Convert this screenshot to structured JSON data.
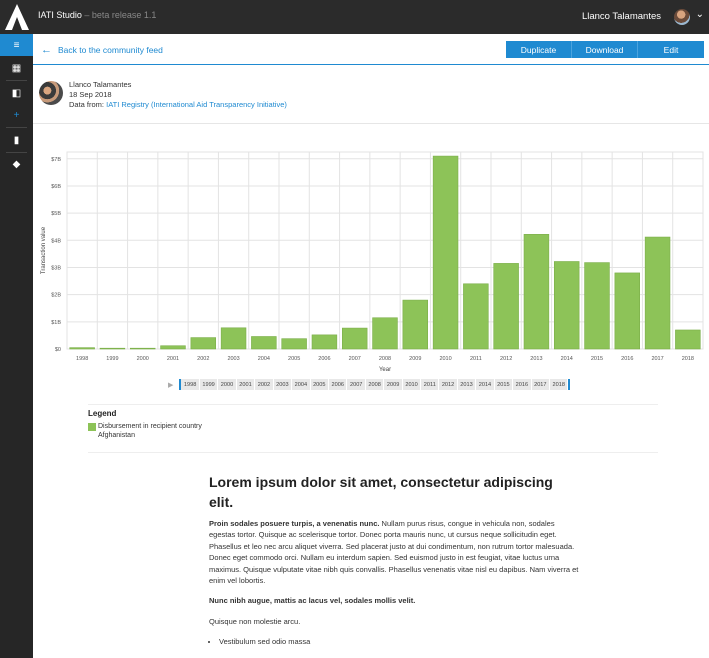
{
  "app": {
    "title": "IATI Studio",
    "subtitle": "– beta release 1.1",
    "user_name": "Llanco Talamantes"
  },
  "sidebar": {
    "items": [
      {
        "icon": "menu-icon",
        "glyph": "≡",
        "active": true
      },
      {
        "icon": "dashboard-icon",
        "glyph": "▦",
        "active": false
      },
      {
        "icon": "gallery-icon",
        "glyph": "◧",
        "active": false
      },
      {
        "icon": "add-icon",
        "glyph": "+",
        "active": false
      },
      {
        "icon": "trash-icon",
        "glyph": "▮",
        "active": false
      },
      {
        "icon": "education-icon",
        "glyph": "◆",
        "active": false
      }
    ]
  },
  "toolbar": {
    "back_label": "Back to the community feed",
    "duplicate_label": "Duplicate",
    "download_label": "Download",
    "edit_label": "Edit"
  },
  "author": {
    "name": "Llanco Talamantes",
    "date": "18 Sep 2018",
    "data_from_label": "Data from:",
    "data_source": "IATI Registry (International Aid Transparency Initiative)"
  },
  "chart_data": {
    "type": "bar",
    "categories": [
      "1998",
      "1999",
      "2000",
      "2001",
      "2002",
      "2003",
      "2004",
      "2005",
      "2006",
      "2007",
      "2008",
      "2009",
      "2010",
      "2011",
      "2012",
      "2013",
      "2014",
      "2015",
      "2016",
      "2017",
      "2018"
    ],
    "values": [
      0.05,
      0.03,
      0.03,
      0.12,
      0.42,
      0.78,
      0.46,
      0.38,
      0.52,
      0.77,
      1.15,
      1.8,
      7.1,
      2.4,
      3.15,
      4.22,
      3.22,
      3.18,
      2.8,
      4.12,
      0.7
    ],
    "unit": "B",
    "yticks": [
      "$0",
      "$1B",
      "$2B",
      "$3B",
      "$4B",
      "$5B",
      "$6B",
      "$7B"
    ],
    "ylim": [
      0,
      7.25
    ],
    "xlabel": "Year",
    "ylabel": "Transaction value",
    "color": "#8dc358",
    "grid": true
  },
  "timeline": {
    "years": [
      "1998",
      "1999",
      "2000",
      "2001",
      "2002",
      "2003",
      "2004",
      "2005",
      "2006",
      "2007",
      "2008",
      "2009",
      "2010",
      "2011",
      "2012",
      "2013",
      "2014",
      "2015",
      "2016",
      "2017",
      "2018"
    ]
  },
  "legend": {
    "title": "Legend",
    "entry_line1": "Disbursement in recipient country",
    "entry_line2": "Afghanistan",
    "color": "#8dc358"
  },
  "article": {
    "heading": "Lorem ipsum dolor sit amet, consectetur adipiscing elit.",
    "p1_bold": "Proin sodales posuere turpis, a venenatis nunc.",
    "p1_rest": " Nullam purus risus, congue in vehicula non, sodales egestas tortor. Quisque ac scelerisque tortor. Donec porta mauris nunc, ut cursus neque sollicitudin eget. Phasellus et leo nec arcu aliquet viverra. Sed placerat justo at dui condimentum, non rutrum tortor malesuada. Donec eget commodo orci. Nullam eu interdum sapien. Sed euismod justo in est feugiat, vitae luctus urna maximus. Quisque vulputate vitae nibh quis convallis. Phasellus venenatis vitae nisl eu dapibus. Nam viverra et enim vel lobortis.",
    "p2_bold": "Nunc nibh augue, mattis ac lacus vel, sodales mollis velit.",
    "p3": "Quisque non molestie arcu.",
    "list": [
      "Vestibulum sed odio massa"
    ]
  }
}
